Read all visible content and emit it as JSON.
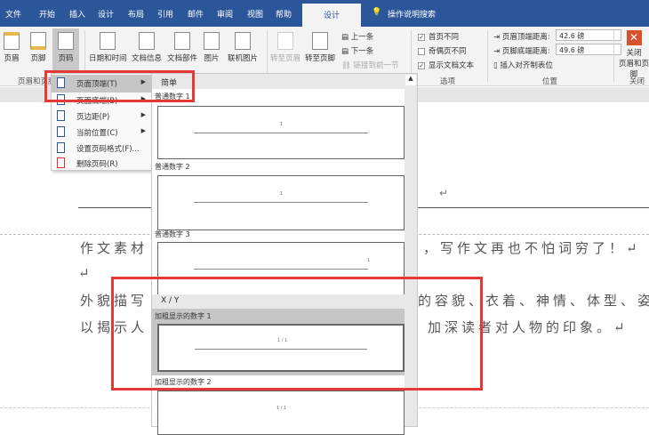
{
  "tabs": [
    "文件",
    "开始",
    "插入",
    "设计",
    "布局",
    "引用",
    "邮件",
    "审阅",
    "视图",
    "帮助",
    "设计"
  ],
  "tell_me": "操作说明搜索",
  "ribbon": {
    "header": "页眉",
    "footer": "页脚",
    "page_number": "页码",
    "date_time": "日期和时间",
    "doc_info": "文档信息",
    "doc_parts": "文档部件",
    "picture": "图片",
    "online_picture": "联机图片",
    "goto_header": "转至页眉",
    "goto_footer": "转至页脚",
    "prev": "上一条",
    "next": "下一条",
    "link_prev": "链接到前一节",
    "diff_first": "首页不同",
    "diff_odd_even": "奇偶页不同",
    "show_text": "显示文档文本",
    "header_top_label": "页眉顶端距离:",
    "header_top_value": "42.6 磅",
    "footer_bottom_label": "页脚底端距离:",
    "footer_bottom_value": "49.6 磅",
    "insert_align_tab": "插入对齐制表位",
    "close_line1": "关闭",
    "close_line2": "页眉和页脚",
    "group_hf": "页眉和页脚",
    "group_options": "选项",
    "group_position": "位置",
    "group_close": "关闭"
  },
  "menu": [
    "页面顶端(T)",
    "页面底端(B)",
    "页边距(P)",
    "当前位置(C)",
    "设置页码格式(F)...",
    "删除页码(R)"
  ],
  "gallery": {
    "section_simple": "简单",
    "plain1": "普通数字 1",
    "plain2": "普通数字 2",
    "plain3": "普通数字 3",
    "section_xy": "X / Y",
    "bold1": "加粗显示的数字 1",
    "bold2": "加粗显示的数字 2",
    "sample_num": "1",
    "sample_xy": "1 / 1"
  },
  "document": {
    "line1_left": "作文素材",
    "line1_right": "，写作文再也不怕词穷了！↵",
    "line2": "↵",
    "line3_left": "外貌描写",
    "line3_right": "的容貌、衣着、神情、体型、姿",
    "line4_left": "以揭示人",
    "line4_right": "加深读者对人物的印象。↵",
    "header_mark": "↵"
  },
  "colors": {
    "accent": "#2b579a",
    "highlight": "#e53935"
  }
}
